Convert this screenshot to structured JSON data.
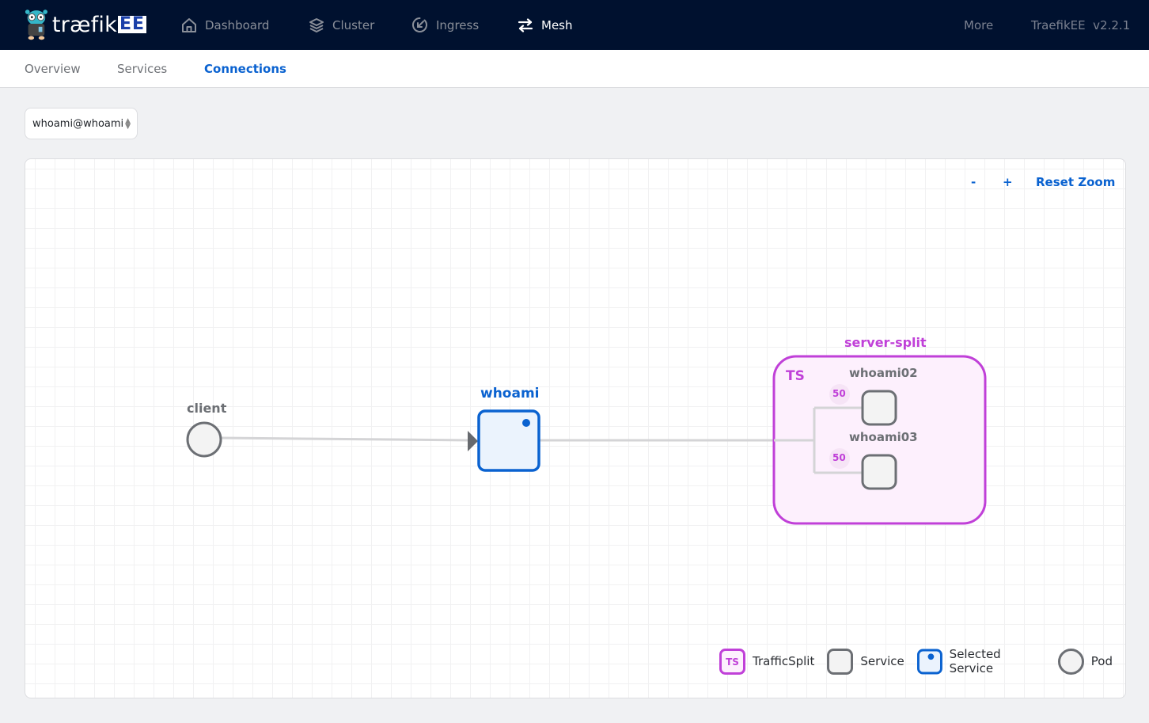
{
  "header": {
    "brand": {
      "word": "træfik",
      "badge": "EE",
      "mascot_icon": "gopher-mascot-logo"
    },
    "nav": [
      {
        "label": "Dashboard",
        "icon": "home-icon",
        "active": false
      },
      {
        "label": "Cluster",
        "icon": "layers-icon",
        "active": false
      },
      {
        "label": "Ingress",
        "icon": "ingress-arrow-icon",
        "active": false
      },
      {
        "label": "Mesh",
        "icon": "swap-arrows-icon",
        "active": true
      }
    ],
    "more_label": "More",
    "version_label": "TraefikEE  v2.2.1"
  },
  "subnav": {
    "tabs": [
      {
        "label": "Overview",
        "active": false
      },
      {
        "label": "Services",
        "active": false
      },
      {
        "label": "Connections",
        "active": true
      }
    ]
  },
  "service_select": {
    "value": "whoami@whoami"
  },
  "zoom_controls": {
    "minus": "-",
    "plus": "+",
    "reset": "Reset Zoom"
  },
  "graph": {
    "client": {
      "label": "client",
      "type": "Pod"
    },
    "selected_service": {
      "label": "whoami",
      "type": "Selected Service"
    },
    "traffic_split": {
      "name": "server-split",
      "badge": "TS",
      "backends": [
        {
          "label": "whoami02",
          "weight": "50",
          "type": "Service"
        },
        {
          "label": "whoami03",
          "weight": "50",
          "type": "Service"
        }
      ]
    }
  },
  "legend": [
    {
      "label": "TrafficSplit",
      "badge": "TS"
    },
    {
      "label": "Service"
    },
    {
      "label": "Selected Service"
    },
    {
      "label": "Pod"
    }
  ],
  "colors": {
    "navbar_bg": "#00112f",
    "accent_blue": "#0a62d0",
    "traffic_split_purple": "#c040d8",
    "traffic_split_fill": "#fdf0fd",
    "service_border": "#6c6f74",
    "edge_gray": "#d4d4d6"
  }
}
